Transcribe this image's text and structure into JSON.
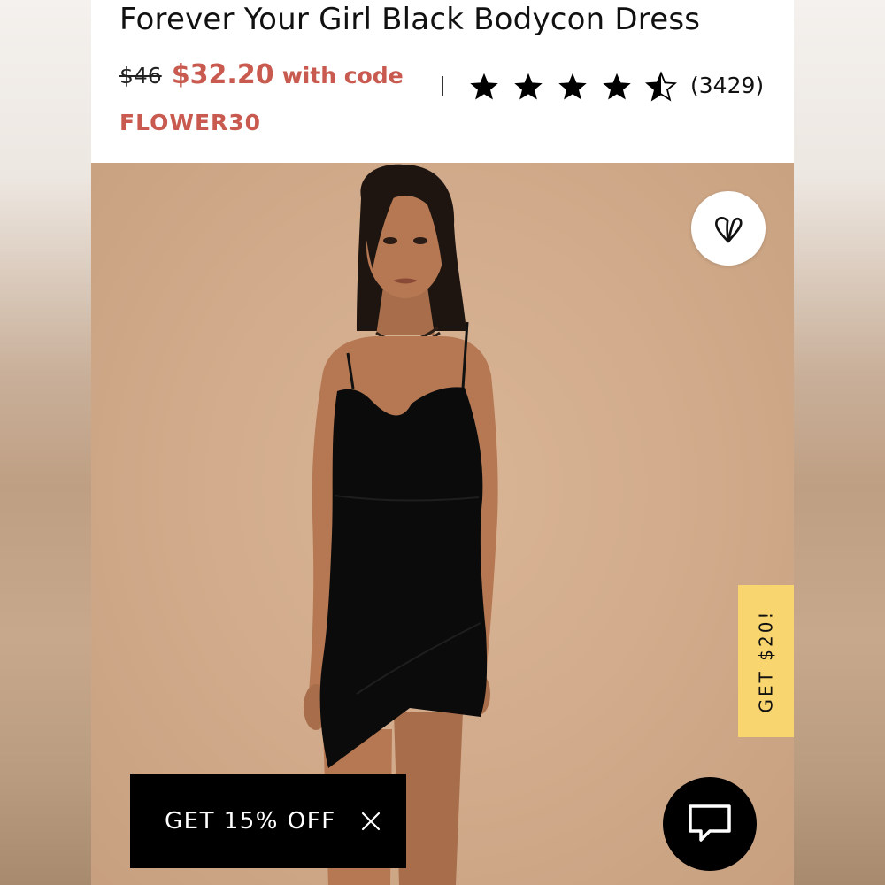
{
  "product": {
    "title": "Forever Your Girl Black Bodycon Dress",
    "original_price": "$46",
    "sale_price": "$32.20",
    "with_code_label": "with code",
    "promo_code": "FLOWER30",
    "rating_stars": 4.5,
    "rating_max": 5,
    "review_count": "(3429)"
  },
  "image": {
    "alt": "Model wearing black bodycon dress"
  },
  "overlays": {
    "side_tab_label": "GET $20!",
    "promo_bar_label": "GET 15% OFF"
  },
  "icons": {
    "favorite": "heart-icon",
    "close": "close-icon",
    "chat": "chat-bubble-icon",
    "star": "star-icon"
  },
  "colors": {
    "sale_red": "#c85a4f",
    "side_tab_yellow": "#f8d56e",
    "promo_black": "#000000",
    "hero_background": "#d2ac8c"
  }
}
